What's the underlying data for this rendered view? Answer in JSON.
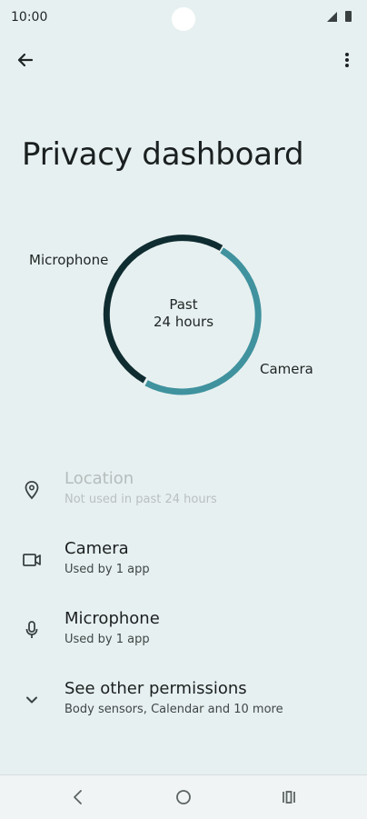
{
  "status": {
    "time": "10:00"
  },
  "header": {
    "title": "Privacy dashboard"
  },
  "chart": {
    "center_line1": "Past",
    "center_line2": "24 hours",
    "segments": [
      {
        "label": "Microphone",
        "color": "#0f2c31"
      },
      {
        "label": "Camera",
        "color": "#3f929e"
      }
    ]
  },
  "permissions": [
    {
      "title": "Location",
      "subtitle": "Not used in past 24 hours",
      "icon": "location-pin-icon",
      "enabled": false
    },
    {
      "title": "Camera",
      "subtitle": "Used by 1 app",
      "icon": "camera-icon",
      "enabled": true
    },
    {
      "title": "Microphone",
      "subtitle": "Used by 1 app",
      "icon": "microphone-icon",
      "enabled": true
    },
    {
      "title": "See other permissions",
      "subtitle": "Body sensors, Calendar and 10 more",
      "icon": "chevron-down-icon",
      "enabled": true
    }
  ],
  "colors": {
    "background": "#e7f0f0",
    "accent": "#3f929e",
    "dark": "#0f2c31"
  }
}
